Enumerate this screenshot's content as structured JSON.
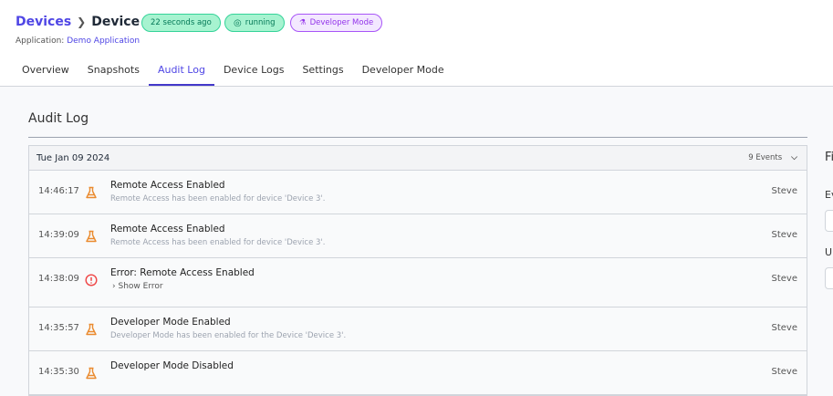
{
  "header": {
    "breadcrumb_root": "Devices",
    "device_name": "Device 3",
    "last_seen": "22 seconds ago",
    "status": "running",
    "mode_badge": "Developer Mode",
    "application_label": "Application:",
    "application_name": "Demo Application"
  },
  "tabs": [
    {
      "label": "Overview"
    },
    {
      "label": "Snapshots"
    },
    {
      "label": "Audit Log",
      "active": true
    },
    {
      "label": "Device Logs"
    },
    {
      "label": "Settings"
    },
    {
      "label": "Developer Mode"
    }
  ],
  "main": {
    "title": "Audit Log",
    "group": {
      "date": "Tue Jan 09 2024",
      "count": "9 Events"
    },
    "events": [
      {
        "time": "14:46:17",
        "icon": "flask-icon",
        "title": "Remote Access Enabled",
        "description": "Remote Access has been enabled for device 'Device 3'.",
        "user": "Steve"
      },
      {
        "time": "14:39:09",
        "icon": "flask-icon",
        "title": "Remote Access Enabled",
        "description": "Remote Access has been enabled for device 'Device 3'.",
        "user": "Steve"
      },
      {
        "time": "14:38:09",
        "icon": "error-icon",
        "title": "Error: Remote Access Enabled",
        "show_error": "Show Error",
        "user": "Steve"
      },
      {
        "time": "14:35:57",
        "icon": "flask-icon",
        "title": "Developer Mode Enabled",
        "description": "Developer Mode has been enabled for the Device 'Device 3'.",
        "user": "Steve"
      },
      {
        "time": "14:35:30",
        "icon": "flask-icon",
        "title": "Developer Mode Disabled",
        "user": "Steve"
      }
    ]
  },
  "sidebar": {
    "title": "Fi",
    "event_label": "Ev",
    "user_label": "U"
  },
  "colors": {
    "accent": "#4f46e5",
    "flask": "#ea8a2e",
    "error": "#ef4444"
  }
}
